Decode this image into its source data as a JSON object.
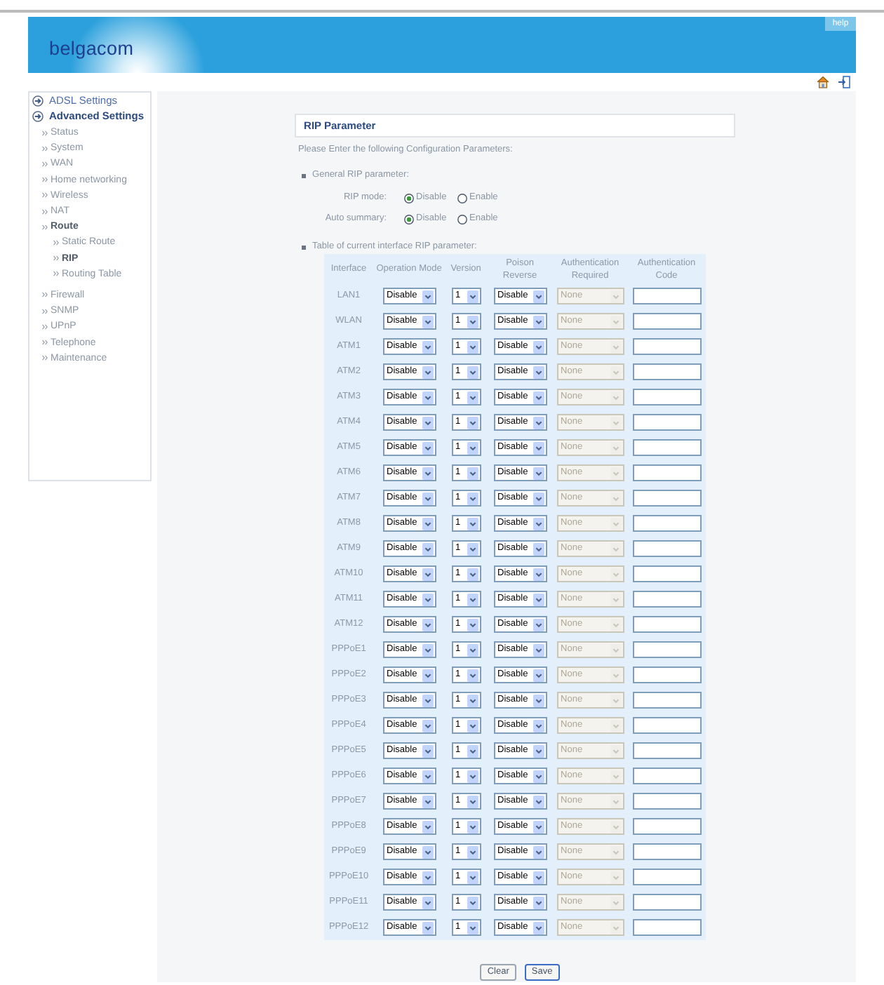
{
  "header": {
    "logo": "belgacom",
    "help_link": "help"
  },
  "sidebar": {
    "items": [
      {
        "label": "ADSL Settings",
        "selected": false
      },
      {
        "label": "Advanced Settings",
        "selected": true,
        "children": [
          {
            "label": "Status",
            "selected": false
          },
          {
            "label": "System",
            "selected": false
          },
          {
            "label": "WAN",
            "selected": false
          },
          {
            "label": "Home networking",
            "selected": false
          },
          {
            "label": "Wireless",
            "selected": false
          },
          {
            "label": "NAT",
            "selected": false
          },
          {
            "label": "Route",
            "selected": true,
            "children": [
              {
                "label": "Static Route",
                "selected": false
              },
              {
                "label": "RIP",
                "selected": true
              },
              {
                "label": "Routing Table",
                "selected": false
              }
            ]
          },
          {
            "label": "Firewall",
            "selected": false
          },
          {
            "label": "SNMP",
            "selected": false
          },
          {
            "label": "UPnP",
            "selected": false
          },
          {
            "label": "Telephone",
            "selected": false
          },
          {
            "label": "Maintenance",
            "selected": false
          }
        ]
      }
    ]
  },
  "form": {
    "title": "RIP Parameter",
    "intro": "Please Enter the following Configuration Parameters:",
    "general": {
      "heading": "General RIP parameter:",
      "fields": [
        {
          "label": "RIP mode:",
          "options": [
            {
              "label": "Disable",
              "selected": true
            },
            {
              "label": "Enable",
              "selected": false
            }
          ]
        },
        {
          "label": "Auto summary:",
          "options": [
            {
              "label": "Disable",
              "selected": true
            },
            {
              "label": "Enable",
              "selected": false
            }
          ]
        }
      ]
    },
    "table": {
      "heading": "Table of current interface RIP parameter:",
      "columns": [
        "Interface",
        "Operation Mode",
        "Version",
        "Poison Reverse",
        "Authentication Required",
        "Authentication Code"
      ],
      "rows": [
        {
          "interface": "LAN1",
          "operation_mode": "Disable",
          "version": "1",
          "poison_reverse": "Disable",
          "authentication_required": {
            "value": "None",
            "disabled": true
          }
        },
        {
          "interface": "WLAN",
          "operation_mode": "Disable",
          "version": "1",
          "poison_reverse": "Disable",
          "authentication_required": {
            "value": "None",
            "disabled": true
          }
        },
        {
          "interface": "ATM1",
          "operation_mode": "Disable",
          "version": "1",
          "poison_reverse": "Disable",
          "authentication_required": {
            "value": "None",
            "disabled": true
          }
        },
        {
          "interface": "ATM2",
          "operation_mode": "Disable",
          "version": "1",
          "poison_reverse": "Disable",
          "authentication_required": {
            "value": "None",
            "disabled": true
          }
        },
        {
          "interface": "ATM3",
          "operation_mode": "Disable",
          "version": "1",
          "poison_reverse": "Disable",
          "authentication_required": {
            "value": "None",
            "disabled": true
          }
        },
        {
          "interface": "ATM4",
          "operation_mode": "Disable",
          "version": "1",
          "poison_reverse": "Disable",
          "authentication_required": {
            "value": "None",
            "disabled": true
          }
        },
        {
          "interface": "ATM5",
          "operation_mode": "Disable",
          "version": "1",
          "poison_reverse": "Disable",
          "authentication_required": {
            "value": "None",
            "disabled": true
          }
        },
        {
          "interface": "ATM6",
          "operation_mode": "Disable",
          "version": "1",
          "poison_reverse": "Disable",
          "authentication_required": {
            "value": "None",
            "disabled": true
          }
        },
        {
          "interface": "ATM7",
          "operation_mode": "Disable",
          "version": "1",
          "poison_reverse": "Disable",
          "authentication_required": {
            "value": "None",
            "disabled": true
          }
        },
        {
          "interface": "ATM8",
          "operation_mode": "Disable",
          "version": "1",
          "poison_reverse": "Disable",
          "authentication_required": {
            "value": "None",
            "disabled": true
          }
        },
        {
          "interface": "ATM9",
          "operation_mode": "Disable",
          "version": "1",
          "poison_reverse": "Disable",
          "authentication_required": {
            "value": "None",
            "disabled": true
          }
        },
        {
          "interface": "ATM10",
          "operation_mode": "Disable",
          "version": "1",
          "poison_reverse": "Disable",
          "authentication_required": {
            "value": "None",
            "disabled": true
          }
        },
        {
          "interface": "ATM11",
          "operation_mode": "Disable",
          "version": "1",
          "poison_reverse": "Disable",
          "authentication_required": {
            "value": "None",
            "disabled": true
          }
        },
        {
          "interface": "ATM12",
          "operation_mode": "Disable",
          "version": "1",
          "poison_reverse": "Disable",
          "authentication_required": {
            "value": "None",
            "disabled": true
          }
        },
        {
          "interface": "PPPoE1",
          "operation_mode": "Disable",
          "version": "1",
          "poison_reverse": "Disable",
          "authentication_required": {
            "value": "None",
            "disabled": true
          }
        },
        {
          "interface": "PPPoE2",
          "operation_mode": "Disable",
          "version": "1",
          "poison_reverse": "Disable",
          "authentication_required": {
            "value": "None",
            "disabled": true
          }
        },
        {
          "interface": "PPPoE3",
          "operation_mode": "Disable",
          "version": "1",
          "poison_reverse": "Disable",
          "authentication_required": {
            "value": "None",
            "disabled": true
          }
        },
        {
          "interface": "PPPoE4",
          "operation_mode": "Disable",
          "version": "1",
          "poison_reverse": "Disable",
          "authentication_required": {
            "value": "None",
            "disabled": true
          }
        },
        {
          "interface": "PPPoE5",
          "operation_mode": "Disable",
          "version": "1",
          "poison_reverse": "Disable",
          "authentication_required": {
            "value": "None",
            "disabled": true
          }
        },
        {
          "interface": "PPPoE6",
          "operation_mode": "Disable",
          "version": "1",
          "poison_reverse": "Disable",
          "authentication_required": {
            "value": "None",
            "disabled": true
          }
        },
        {
          "interface": "PPPoE7",
          "operation_mode": "Disable",
          "version": "1",
          "poison_reverse": "Disable",
          "authentication_required": {
            "value": "None",
            "disabled": true
          }
        },
        {
          "interface": "PPPoE8",
          "operation_mode": "Disable",
          "version": "1",
          "poison_reverse": "Disable",
          "authentication_required": {
            "value": "None",
            "disabled": true
          }
        },
        {
          "interface": "PPPoE9",
          "operation_mode": "Disable",
          "version": "1",
          "poison_reverse": "Disable",
          "authentication_required": {
            "value": "None",
            "disabled": true
          }
        },
        {
          "interface": "PPPoE10",
          "operation_mode": "Disable",
          "version": "1",
          "poison_reverse": "Disable",
          "authentication_required": {
            "value": "None",
            "disabled": true
          }
        },
        {
          "interface": "PPPoE11",
          "operation_mode": "Disable",
          "version": "1",
          "poison_reverse": "Disable",
          "authentication_required": {
            "value": "None",
            "disabled": true
          }
        },
        {
          "interface": "PPPoE12",
          "operation_mode": "Disable",
          "version": "1",
          "poison_reverse": "Disable",
          "authentication_required": {
            "value": "None",
            "disabled": true
          }
        }
      ]
    },
    "buttons": [
      {
        "label": "Clear",
        "default": false
      },
      {
        "label": "Save",
        "default": true
      }
    ]
  }
}
